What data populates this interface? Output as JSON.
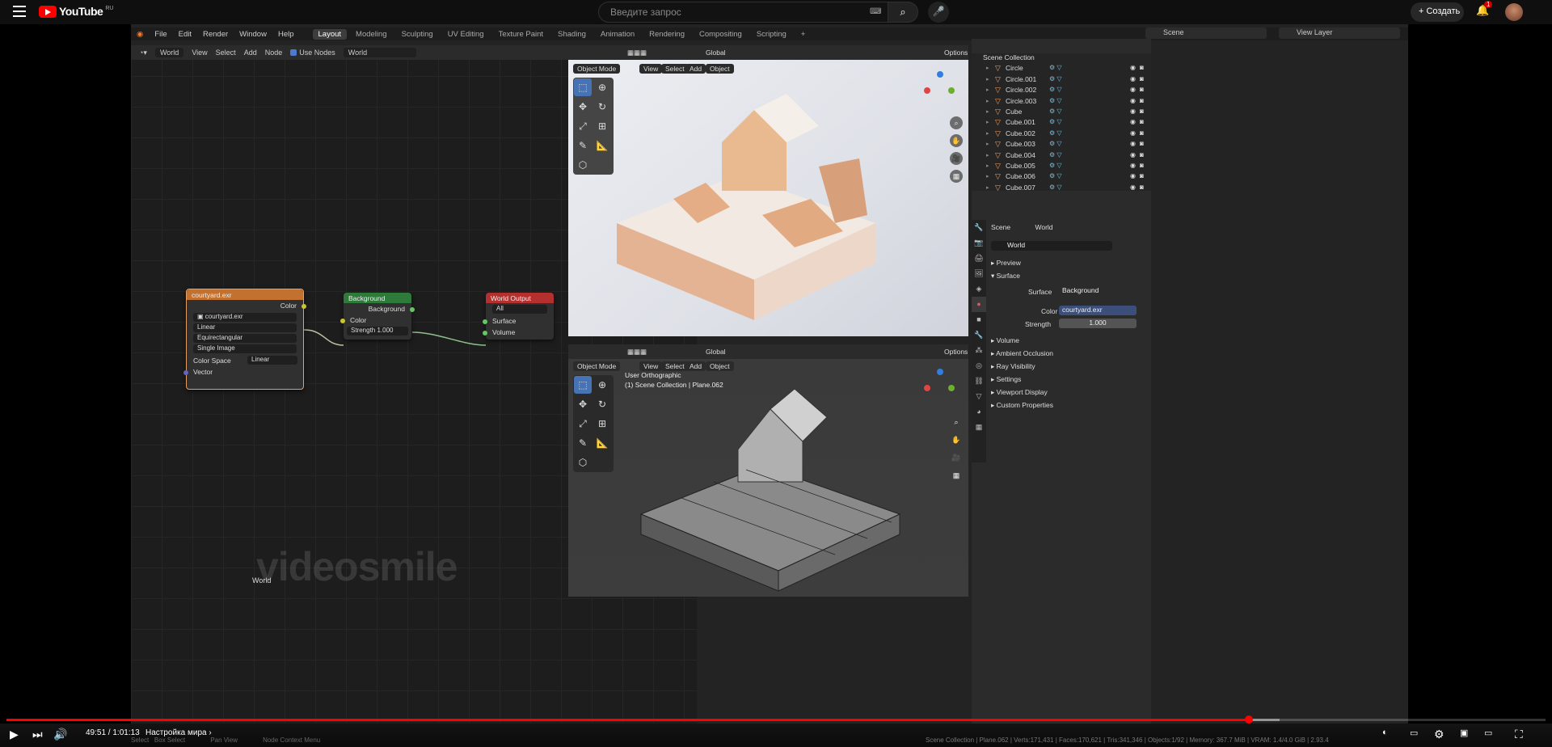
{
  "youtube": {
    "logo_text": "YouTube",
    "logo_region": "RU",
    "search_placeholder": "Введите запрос",
    "create_label": "Создать",
    "notif_count": "1",
    "time_current": "49:51",
    "time_total": "1:01:13",
    "time_display": "49:51 / 1:01:13",
    "chapter": "Настройка мира",
    "progress_fraction": 0.807,
    "accent": "#ff0000"
  },
  "blender": {
    "menus": [
      "File",
      "Edit",
      "Render",
      "Window",
      "Help"
    ],
    "workspaces": [
      "Layout",
      "Modeling",
      "Sculpting",
      "UV Editing",
      "Texture Paint",
      "Shading",
      "Animation",
      "Rendering",
      "Compositing",
      "Scripting"
    ],
    "active_workspace": "Layout",
    "scene": "Scene",
    "view_layer": "View Layer",
    "node_editor": {
      "type": "World",
      "menus": [
        "View",
        "Select",
        "Add",
        "Node"
      ],
      "use_nodes": "Use Nodes",
      "world_name": "World",
      "footer_label": "World"
    },
    "nodes": {
      "image": {
        "title": "courtyard.exr",
        "output": "Color",
        "image_name": "courtyard.exr",
        "interp": "Linear",
        "projection": "Equirectangular",
        "source": "Single Image",
        "colorspace_label": "Color Space",
        "colorspace": "Linear",
        "input": "Vector"
      },
      "background": {
        "title": "Background",
        "output": "Background",
        "color": "Color",
        "strength_label": "Strength",
        "strength": "1.000"
      },
      "output": {
        "title": "World Output",
        "target": "All",
        "surface": "Surface",
        "volume": "Volume"
      }
    },
    "viewport": {
      "mode": "Object Mode",
      "menus": [
        "View",
        "Select",
        "Add",
        "Object"
      ],
      "orientation": "Global",
      "options": "Options",
      "view_name": "User Orthographic",
      "collection_info": "(1) Scene Collection | Plane.062"
    },
    "outliner": {
      "root": "Scene Collection",
      "items": [
        "Circle",
        "Circle.001",
        "Circle.002",
        "Circle.003",
        "Cube",
        "Cube.001",
        "Cube.002",
        "Cube.003",
        "Cube.004",
        "Cube.005",
        "Cube.006",
        "Cube.007"
      ]
    },
    "properties": {
      "breadcrumb_scene": "Scene",
      "breadcrumb_world": "World",
      "world_name": "World",
      "preview": "Preview",
      "surface_section": "Surface",
      "surface_label": "Surface",
      "surface_value": "Background",
      "color_label": "Color",
      "color_value": "courtyard.exr",
      "strength_label": "Strength",
      "strength_value": "1.000",
      "sections": [
        "Volume",
        "Ambient Occlusion",
        "Ray Visibility",
        "Settings",
        "Viewport Display",
        "Custom Properties"
      ]
    },
    "status_bar": "Scene Collection | Plane.062 | Verts:171,431 | Faces:170,621 | Tris:341,346 | Objects:1/92 | Memory: 367.7 MiB | VRAM: 1.4/4.0 GiB | 2.93.4",
    "hints": [
      "Select",
      "Box Select",
      "Pan View",
      "Node Context Menu"
    ],
    "watermark": "videosmile"
  }
}
